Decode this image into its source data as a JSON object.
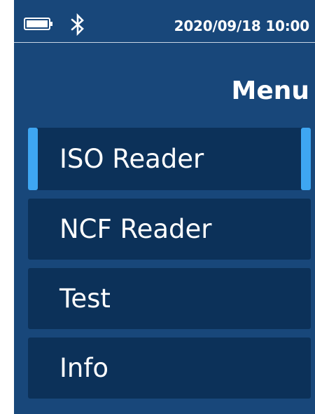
{
  "statusbar": {
    "datetime": "2020/09/18 10:00",
    "battery_icon": "battery-full-icon",
    "bluetooth_icon": "bluetooth-icon"
  },
  "title": "Menu",
  "menu": {
    "selected_index": 0,
    "items": [
      {
        "label": "ISO Reader"
      },
      {
        "label": "NCF Reader"
      },
      {
        "label": "Test"
      },
      {
        "label": "Info"
      }
    ]
  },
  "colors": {
    "background": "#18477a",
    "item_background": "#0c3159",
    "selection_accent": "#3ea6f2",
    "text": "#ffffff"
  }
}
